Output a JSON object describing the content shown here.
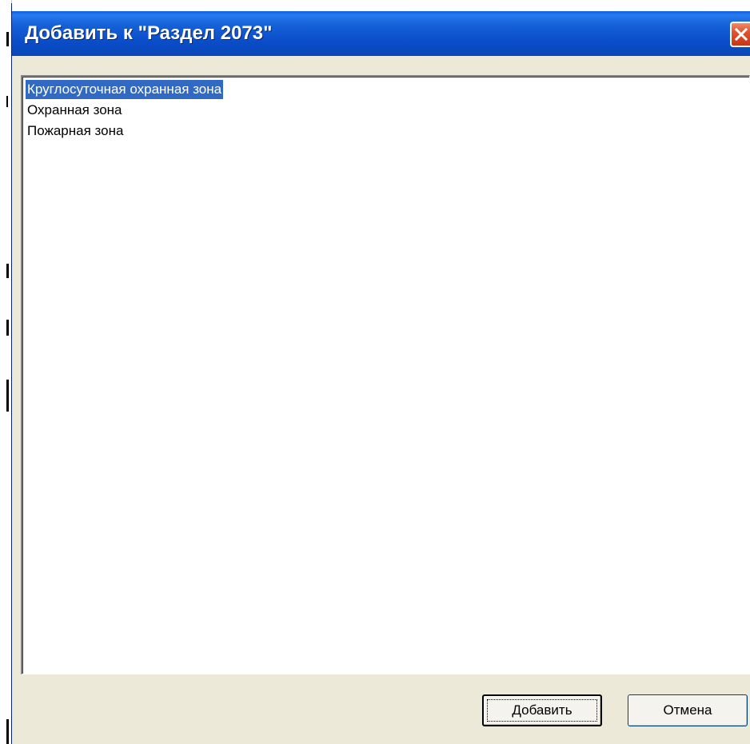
{
  "dialog": {
    "title": "Добавить к \"Раздел 2073\"",
    "close_icon": "close-icon"
  },
  "list": {
    "items": [
      {
        "label": "Круглосуточная охранная зона",
        "selected": true
      },
      {
        "label": "Охранная зона",
        "selected": false
      },
      {
        "label": "Пожарная зона",
        "selected": false
      }
    ]
  },
  "buttons": {
    "add_label": "Добавить",
    "cancel_label": "Отмена"
  },
  "colors": {
    "titlebar": "#0a4cc8",
    "selection": "#316ac5",
    "dialog_bg": "#ece9d8",
    "close": "#e0522c"
  }
}
